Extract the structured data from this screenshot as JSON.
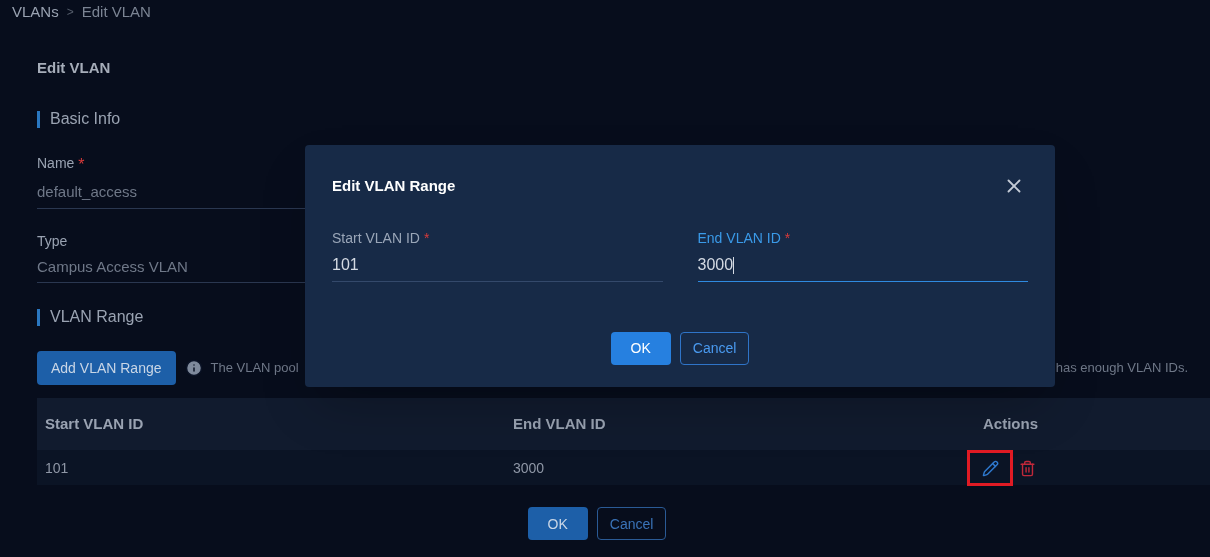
{
  "breadcrumb": [
    "VLANs",
    "Edit VLAN"
  ],
  "breadcrumb_separator": ">",
  "page_title": "Edit VLAN",
  "sections": [
    {
      "title": "Basic Info"
    },
    {
      "title": "VLAN Range"
    }
  ],
  "fields": [
    {
      "label": "Name",
      "required": true,
      "value": "default_access"
    },
    {
      "label": "Type",
      "required": false,
      "value": "Campus Access VLAN"
    }
  ],
  "add_button": "Add VLAN Range",
  "info_text_start": "The VLAN pool",
  "required_mark": "*",
  "info_text_end": "has enough VLAN IDs.",
  "table": {
    "columns": [
      "Start VLAN ID",
      "End VLAN ID",
      "Actions"
    ],
    "rows": [
      {
        "cells": [
          "101",
          "3000"
        ],
        "edit_highlighted": true
      }
    ]
  },
  "footer_buttons": [
    {
      "label": "OK",
      "kind": "primary"
    },
    {
      "label": "Cancel",
      "kind": "secondary"
    }
  ],
  "dialog": {
    "title": "Edit VLAN Range",
    "fields": [
      {
        "label": "Start VLAN ID",
        "required": true,
        "value": "101",
        "focused": false
      },
      {
        "label": "End VLAN ID",
        "required": true,
        "value": "3000",
        "focused": true
      }
    ],
    "buttons": [
      {
        "label": "OK",
        "kind": "primary"
      },
      {
        "label": "Cancel",
        "kind": "secondary"
      }
    ]
  }
}
